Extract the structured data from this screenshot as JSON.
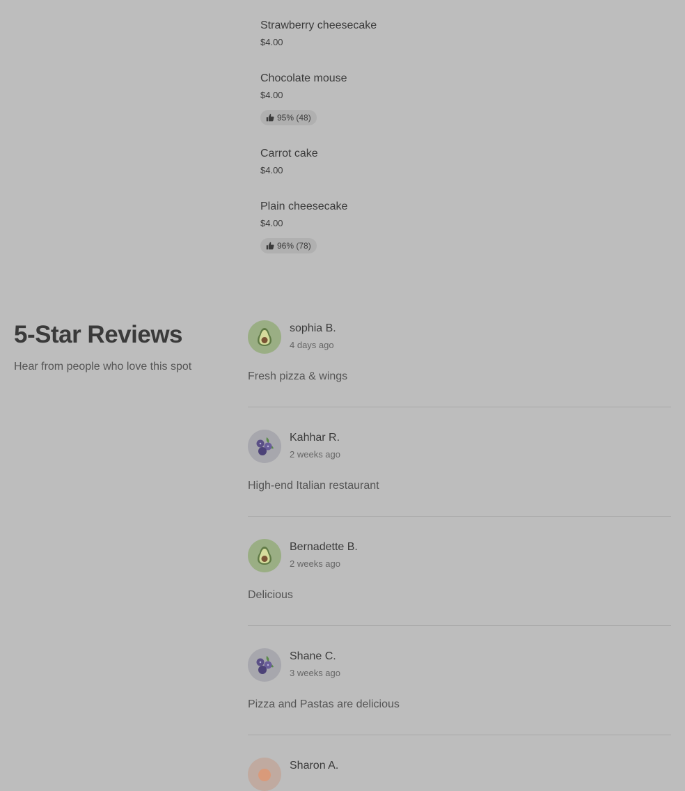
{
  "menu": {
    "items": [
      {
        "name": "Strawberry cheesecake",
        "price": "$4.00"
      },
      {
        "name": "Chocolate mouse",
        "price": "$4.00",
        "rating": "95% (48)"
      },
      {
        "name": "Carrot cake",
        "price": "$4.00"
      },
      {
        "name": "Plain cheesecake",
        "price": "$4.00",
        "rating": "96% (78)"
      }
    ]
  },
  "reviews": {
    "title": "5-Star Reviews",
    "subtitle": "Hear from people who love this spot",
    "items": [
      {
        "name": "sophia B.",
        "time": "4 days ago",
        "text": "Fresh pizza & wings",
        "avatar": "avocado-icon"
      },
      {
        "name": "Kahhar R.",
        "time": "2 weeks ago",
        "text": "High-end Italian restaurant",
        "avatar": "blueberry-icon"
      },
      {
        "name": "Bernadette B.",
        "time": "2 weeks ago",
        "text": "Delicious",
        "avatar": "avocado-icon"
      },
      {
        "name": "Shane C.",
        "time": "3 weeks ago",
        "text": "Pizza and Pastas are delicious",
        "avatar": "blueberry-icon"
      },
      {
        "name": "Sharon A.",
        "avatar": "peach-icon"
      }
    ]
  }
}
